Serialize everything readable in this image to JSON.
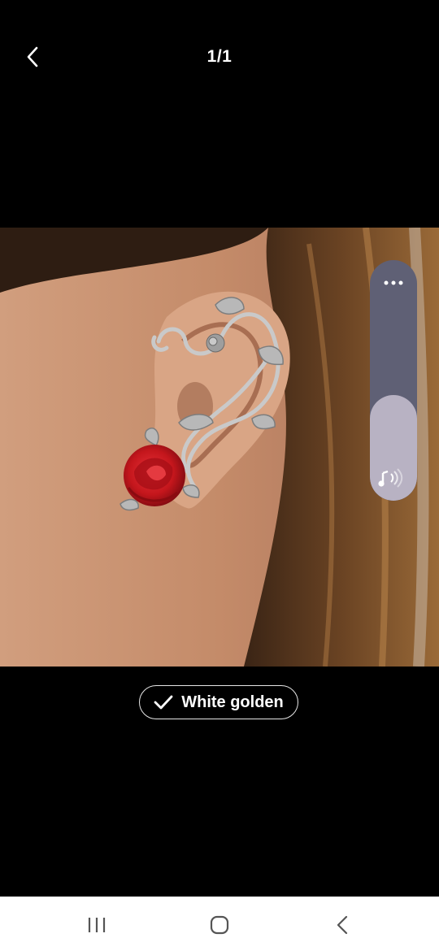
{
  "header": {
    "back_icon": "chevron-left-icon",
    "counter": "1/1"
  },
  "volume": {
    "level": 0.44,
    "more_icon": "more-dots-icon",
    "speaker_icon": "music-volume-icon"
  },
  "variant": {
    "check_icon": "checkmark-icon",
    "label": "White golden"
  },
  "nav": {
    "recents_icon": "recent-apps-icon",
    "home_icon": "home-icon",
    "back_icon": "back-icon"
  },
  "colors": {
    "background": "#000000",
    "volume_track": "#5f6075",
    "volume_fill": "#b8b2c3",
    "navbar": "#ffffff",
    "rose": "#c4161c"
  }
}
